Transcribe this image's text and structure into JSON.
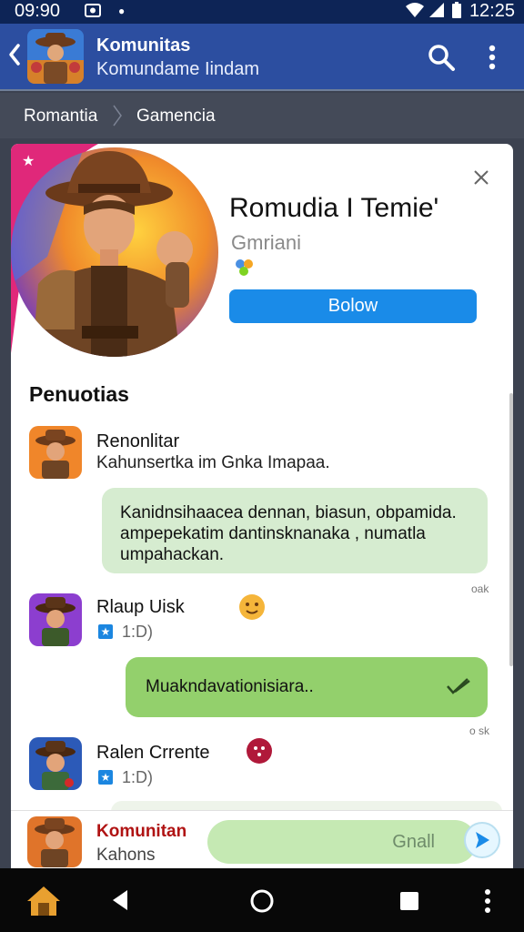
{
  "status_bar": {
    "time": "09:90",
    "clock": "12:25"
  },
  "header": {
    "title": "Komunitas",
    "subtitle": "Komundame Iindam"
  },
  "breadcrumb": [
    "Romantia",
    "Gamencia"
  ],
  "profile": {
    "name": "Romudia I Temie'",
    "subtitle": "Gmriani",
    "follow_label": "Bolow"
  },
  "section_title": "Penuotias",
  "messages": [
    {
      "name": "Renonlitar",
      "text": "Kahunsertka im Gnka Imapaa.",
      "bubble": "Kanidnsihaacea dennan, biasun, obpamida. ampepekatim dantinsknanaka , numatla umpahackan.",
      "time": "oak"
    },
    {
      "name": "Rlaup Uisk",
      "meta": "1:D)",
      "bubble": "Muakndavationisiara..",
      "time": "o sk"
    },
    {
      "name": "Ralen Crrente",
      "meta": "1:D)"
    }
  ],
  "composer": {
    "name": "Komunitan",
    "sub": "Kahons",
    "placeholder": "Gnall"
  },
  "colors": {
    "header": "#2c4ea0",
    "status_bar": "#0d2456",
    "accent": "#1a8be8",
    "bubble_light": "#d6ecd0",
    "bubble_green": "#93d06c"
  }
}
